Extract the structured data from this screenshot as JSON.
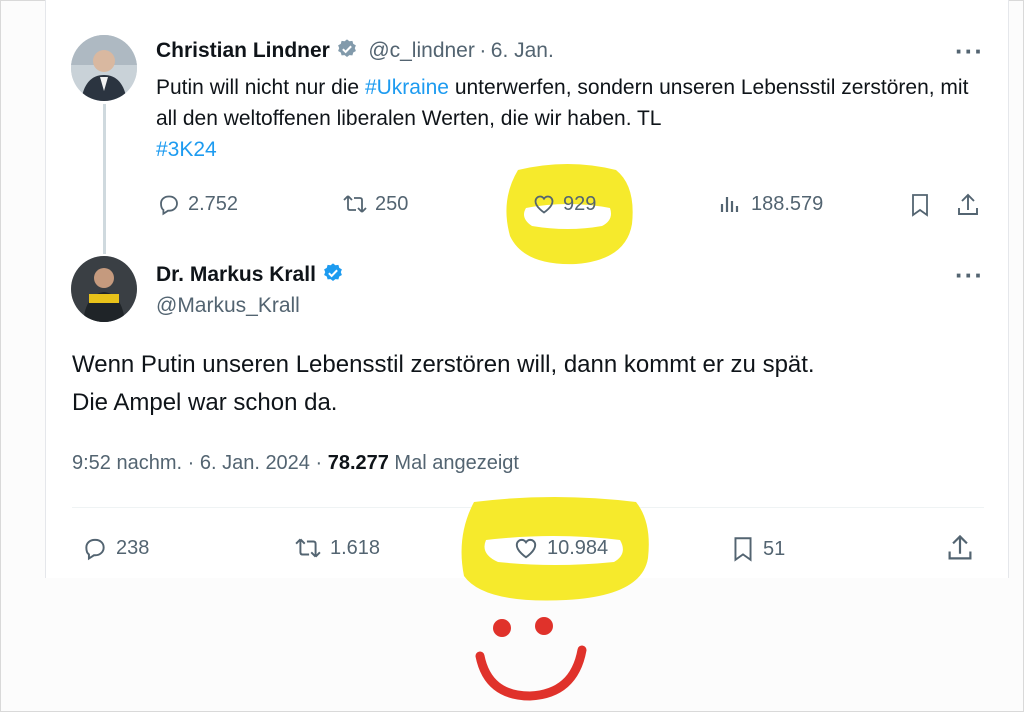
{
  "tweet1": {
    "author": "Christian Lindner",
    "handle": "@c_lindner",
    "separator": "·",
    "date": "6. Jan.",
    "more": "···",
    "text_before": "Putin will nicht nur die ",
    "hashtag_1": "#Ukraine",
    "text_after": " unterwerfen, sondern unseren Lebensstil zerstören, mit all den weltoffenen liberalen Werten, die wir haben. TL",
    "hashtag_2": "#3K24",
    "replies": "2.752",
    "retweets": "250",
    "likes": "929",
    "views": "188.579",
    "verified_color": "#829aab"
  },
  "tweet2": {
    "author": "Dr. Markus Krall",
    "handle": "@Markus_Krall",
    "more": "···",
    "line_1": "Wenn Putin unseren Lebensstil zerstören will, dann kommt er zu spät.",
    "line_2": "Die Ampel war schon da.",
    "time": "9:52 nachm. · 6. Jan. 2024 · ",
    "view_count": "78.277",
    "view_label": " Mal angezeigt",
    "replies": "238",
    "retweets": "1.618",
    "likes": "10.984",
    "bookmarks": "51",
    "verified_color": "#1d9bf0"
  },
  "annotations": {
    "highlight_color": "#f6ea2c",
    "smiley_color": "#e0322b"
  }
}
